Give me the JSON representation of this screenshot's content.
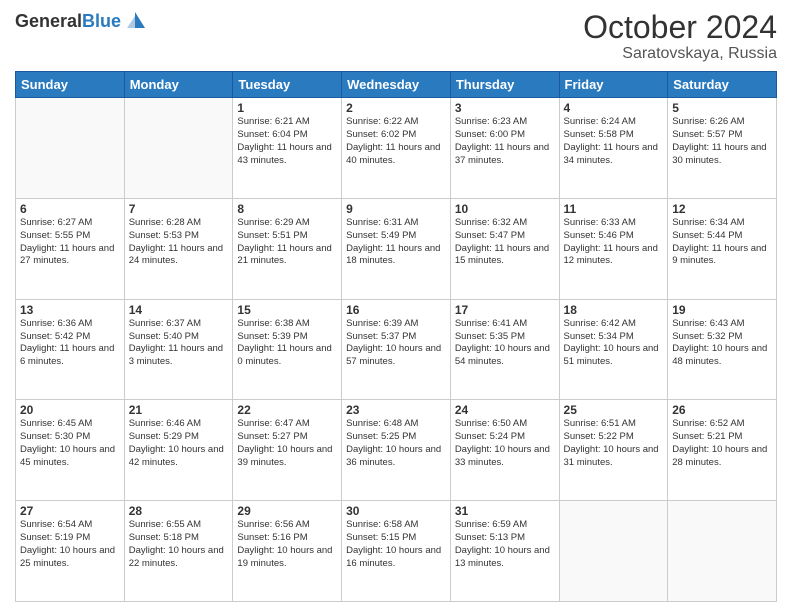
{
  "header": {
    "logo_general": "General",
    "logo_blue": "Blue",
    "main_title": "October 2024",
    "subtitle": "Saratovskaya, Russia"
  },
  "weekdays": [
    "Sunday",
    "Monday",
    "Tuesday",
    "Wednesday",
    "Thursday",
    "Friday",
    "Saturday"
  ],
  "weeks": [
    [
      {
        "day": "",
        "info": ""
      },
      {
        "day": "",
        "info": ""
      },
      {
        "day": "1",
        "info": "Sunrise: 6:21 AM\nSunset: 6:04 PM\nDaylight: 11 hours and 43 minutes."
      },
      {
        "day": "2",
        "info": "Sunrise: 6:22 AM\nSunset: 6:02 PM\nDaylight: 11 hours and 40 minutes."
      },
      {
        "day": "3",
        "info": "Sunrise: 6:23 AM\nSunset: 6:00 PM\nDaylight: 11 hours and 37 minutes."
      },
      {
        "day": "4",
        "info": "Sunrise: 6:24 AM\nSunset: 5:58 PM\nDaylight: 11 hours and 34 minutes."
      },
      {
        "day": "5",
        "info": "Sunrise: 6:26 AM\nSunset: 5:57 PM\nDaylight: 11 hours and 30 minutes."
      }
    ],
    [
      {
        "day": "6",
        "info": "Sunrise: 6:27 AM\nSunset: 5:55 PM\nDaylight: 11 hours and 27 minutes."
      },
      {
        "day": "7",
        "info": "Sunrise: 6:28 AM\nSunset: 5:53 PM\nDaylight: 11 hours and 24 minutes."
      },
      {
        "day": "8",
        "info": "Sunrise: 6:29 AM\nSunset: 5:51 PM\nDaylight: 11 hours and 21 minutes."
      },
      {
        "day": "9",
        "info": "Sunrise: 6:31 AM\nSunset: 5:49 PM\nDaylight: 11 hours and 18 minutes."
      },
      {
        "day": "10",
        "info": "Sunrise: 6:32 AM\nSunset: 5:47 PM\nDaylight: 11 hours and 15 minutes."
      },
      {
        "day": "11",
        "info": "Sunrise: 6:33 AM\nSunset: 5:46 PM\nDaylight: 11 hours and 12 minutes."
      },
      {
        "day": "12",
        "info": "Sunrise: 6:34 AM\nSunset: 5:44 PM\nDaylight: 11 hours and 9 minutes."
      }
    ],
    [
      {
        "day": "13",
        "info": "Sunrise: 6:36 AM\nSunset: 5:42 PM\nDaylight: 11 hours and 6 minutes."
      },
      {
        "day": "14",
        "info": "Sunrise: 6:37 AM\nSunset: 5:40 PM\nDaylight: 11 hours and 3 minutes."
      },
      {
        "day": "15",
        "info": "Sunrise: 6:38 AM\nSunset: 5:39 PM\nDaylight: 11 hours and 0 minutes."
      },
      {
        "day": "16",
        "info": "Sunrise: 6:39 AM\nSunset: 5:37 PM\nDaylight: 10 hours and 57 minutes."
      },
      {
        "day": "17",
        "info": "Sunrise: 6:41 AM\nSunset: 5:35 PM\nDaylight: 10 hours and 54 minutes."
      },
      {
        "day": "18",
        "info": "Sunrise: 6:42 AM\nSunset: 5:34 PM\nDaylight: 10 hours and 51 minutes."
      },
      {
        "day": "19",
        "info": "Sunrise: 6:43 AM\nSunset: 5:32 PM\nDaylight: 10 hours and 48 minutes."
      }
    ],
    [
      {
        "day": "20",
        "info": "Sunrise: 6:45 AM\nSunset: 5:30 PM\nDaylight: 10 hours and 45 minutes."
      },
      {
        "day": "21",
        "info": "Sunrise: 6:46 AM\nSunset: 5:29 PM\nDaylight: 10 hours and 42 minutes."
      },
      {
        "day": "22",
        "info": "Sunrise: 6:47 AM\nSunset: 5:27 PM\nDaylight: 10 hours and 39 minutes."
      },
      {
        "day": "23",
        "info": "Sunrise: 6:48 AM\nSunset: 5:25 PM\nDaylight: 10 hours and 36 minutes."
      },
      {
        "day": "24",
        "info": "Sunrise: 6:50 AM\nSunset: 5:24 PM\nDaylight: 10 hours and 33 minutes."
      },
      {
        "day": "25",
        "info": "Sunrise: 6:51 AM\nSunset: 5:22 PM\nDaylight: 10 hours and 31 minutes."
      },
      {
        "day": "26",
        "info": "Sunrise: 6:52 AM\nSunset: 5:21 PM\nDaylight: 10 hours and 28 minutes."
      }
    ],
    [
      {
        "day": "27",
        "info": "Sunrise: 6:54 AM\nSunset: 5:19 PM\nDaylight: 10 hours and 25 minutes."
      },
      {
        "day": "28",
        "info": "Sunrise: 6:55 AM\nSunset: 5:18 PM\nDaylight: 10 hours and 22 minutes."
      },
      {
        "day": "29",
        "info": "Sunrise: 6:56 AM\nSunset: 5:16 PM\nDaylight: 10 hours and 19 minutes."
      },
      {
        "day": "30",
        "info": "Sunrise: 6:58 AM\nSunset: 5:15 PM\nDaylight: 10 hours and 16 minutes."
      },
      {
        "day": "31",
        "info": "Sunrise: 6:59 AM\nSunset: 5:13 PM\nDaylight: 10 hours and 13 minutes."
      },
      {
        "day": "",
        "info": ""
      },
      {
        "day": "",
        "info": ""
      }
    ]
  ]
}
